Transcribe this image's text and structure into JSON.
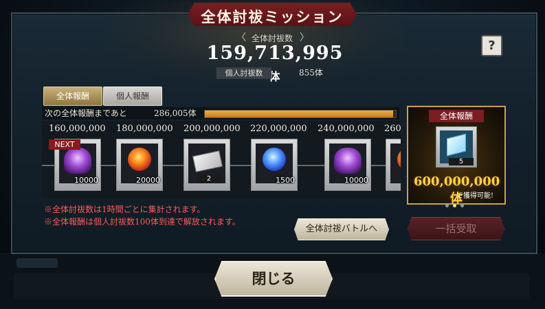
{
  "header": {
    "title": "全体討祓ミッション",
    "total_label": "全体討祓数",
    "total_value": "159,713,995",
    "total_unit": "体",
    "personal_label": "個人討祓数",
    "personal_value": "855体",
    "help_icon": "question-mark-icon"
  },
  "tabs": [
    {
      "label": "全体報酬",
      "active": true
    },
    {
      "label": "個人報酬",
      "active": false
    }
  ],
  "progress": {
    "label": "次の全体報酬まであと",
    "remaining": "286,005体",
    "fraction": 0.985
  },
  "rewards": [
    {
      "threshold": "160,000,000",
      "icon": "purple-monster-icon",
      "count": "10000",
      "next": true
    },
    {
      "threshold": "180,000,000",
      "icon": "fire-orb-icon",
      "count": "20000",
      "next": false
    },
    {
      "threshold": "200,000,000",
      "icon": "ticket-icon",
      "count": "2",
      "next": false
    },
    {
      "threshold": "220,000,000",
      "icon": "blue-orb-icon",
      "count": "1500",
      "next": false
    },
    {
      "threshold": "240,000,000",
      "icon": "purple-monster-icon",
      "count": "10000",
      "next": false
    },
    {
      "threshold": "260",
      "icon": "fire-orb-icon",
      "count": "",
      "next": false
    }
  ],
  "next_badge": "NEXT",
  "side_reward": {
    "title": "全体報酬",
    "icon": "crystal-ticket-icon",
    "count": "5",
    "value": "600,000,000体",
    "note": "で獲得可能!"
  },
  "pagination": {
    "count": 3,
    "active": 1
  },
  "notes": [
    "※全体討祓数は1時間ごとに集計されます。",
    "※全体報酬は個人討祓数100体到達で解放されます。"
  ],
  "buttons": {
    "battle": "全体討祓バトルへ",
    "collect": "一括受取",
    "close": "閉じる"
  },
  "colors": {
    "accent_gold": "#c9a24a",
    "banner_red": "#7a1e22",
    "note_red": "#ff5a5a"
  }
}
